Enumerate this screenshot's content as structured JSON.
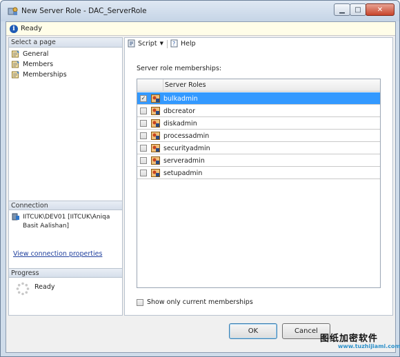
{
  "window": {
    "title": "New Server Role - DAC_ServerRole"
  },
  "status": {
    "text": "Ready"
  },
  "left_pane": {
    "select_page_header": "Select a page",
    "pages": [
      {
        "label": "General",
        "icon": "page-icon"
      },
      {
        "label": "Members",
        "icon": "page-icon"
      },
      {
        "label": "Memberships",
        "icon": "page-icon"
      }
    ],
    "connection_header": "Connection",
    "connection_line1": "IITCUK\\DEV01 [IITCUK\\Aniqa",
    "connection_line2": "Basit Aalishan]",
    "connection_link": "View connection properties",
    "progress_header": "Progress",
    "progress_status": "Ready"
  },
  "toolbar": {
    "script_label": "Script",
    "help_label": "Help"
  },
  "main": {
    "section_label": "Server role memberships:",
    "column_header": "Server Roles",
    "rows": [
      {
        "name": "bulkadmin",
        "checked": true,
        "selected": true
      },
      {
        "name": "dbcreator",
        "checked": false,
        "selected": false
      },
      {
        "name": "diskadmin",
        "checked": false,
        "selected": false
      },
      {
        "name": "processadmin",
        "checked": false,
        "selected": false
      },
      {
        "name": "securityadmin",
        "checked": false,
        "selected": false
      },
      {
        "name": "serveradmin",
        "checked": false,
        "selected": false
      },
      {
        "name": "setupadmin",
        "checked": false,
        "selected": false
      }
    ],
    "show_only_label": "Show only current memberships",
    "show_only_checked": false
  },
  "buttons": {
    "ok": "OK",
    "cancel": "Cancel"
  },
  "watermark": {
    "text": "图纸加密软件",
    "url": "www.tuzhijiami.com"
  },
  "colors": {
    "selection": "#3399ff",
    "status_bg": "#fffde8",
    "link": "#1f3f9d"
  }
}
